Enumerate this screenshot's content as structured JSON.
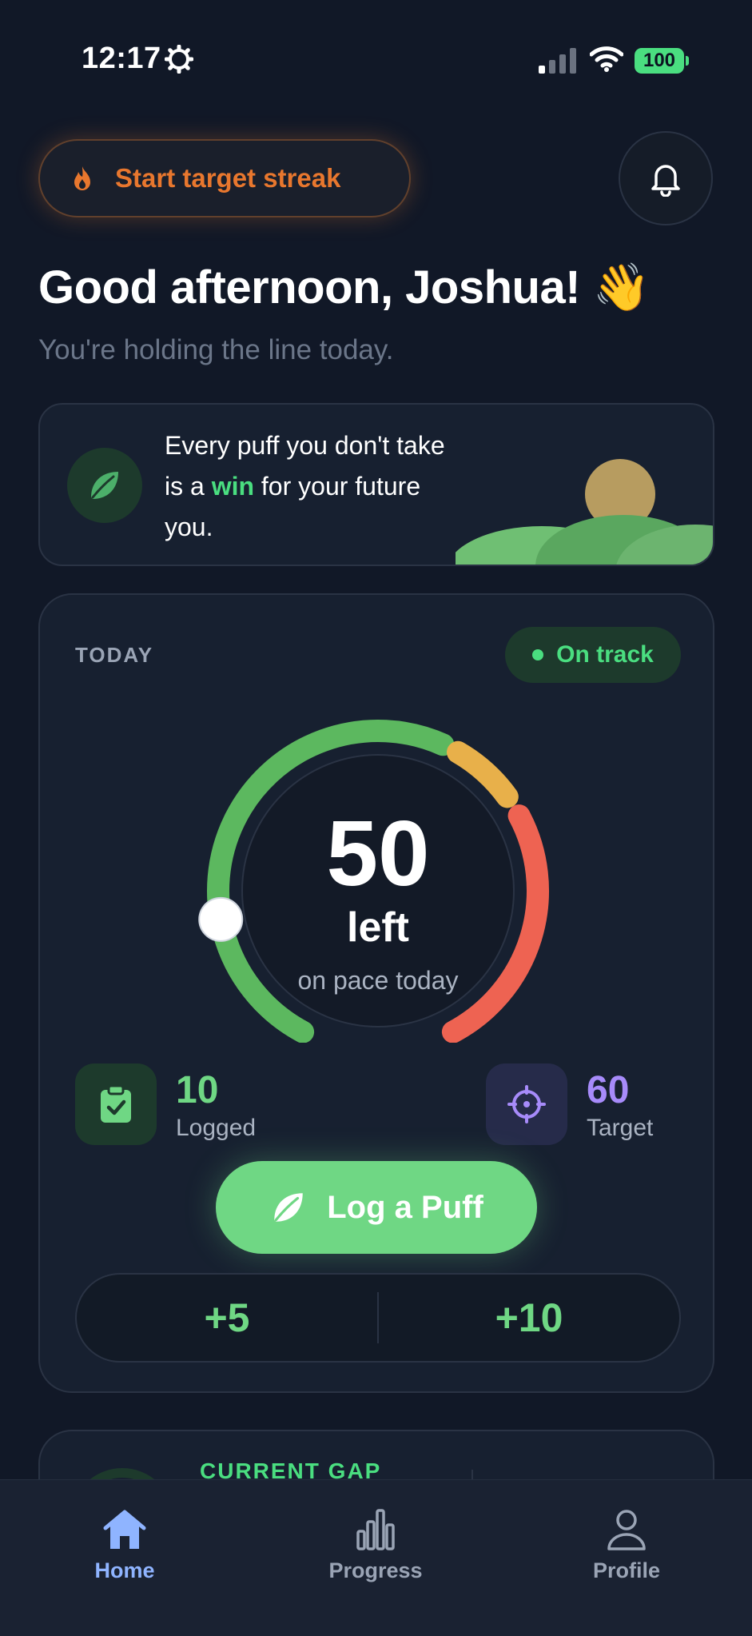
{
  "status_bar": {
    "time": "12:17",
    "battery": "100"
  },
  "header": {
    "streak_label": "Start target streak"
  },
  "greeting": {
    "title": "Good afternoon, Joshua! 👋",
    "subtitle": "You're holding the line today."
  },
  "quote": {
    "before": "Every puff you don't take is a",
    "highlight": "win",
    "after": "for your future you."
  },
  "today": {
    "label": "TODAY",
    "status": "On track",
    "remaining": "50",
    "remaining_label": "left",
    "pace_label": "on pace today",
    "progress_fraction": 0.17,
    "logged": {
      "value": "10",
      "label": "Logged"
    },
    "target": {
      "value": "60",
      "label": "Target"
    },
    "log_button": "Log a Puff",
    "quick_add": [
      "+5",
      "+10"
    ]
  },
  "gap_card": {
    "label": "CURRENT GAP"
  },
  "tabs": [
    {
      "label": "Home",
      "icon": "home-icon",
      "active": true
    },
    {
      "label": "Progress",
      "icon": "bar-chart-icon",
      "active": false
    },
    {
      "label": "Profile",
      "icon": "user-icon",
      "active": false
    }
  ],
  "colors": {
    "accent_green": "#6fd784",
    "streak_orange": "#e8772e",
    "active_tab": "#8fb4ff",
    "target_purple": "#a78bfa"
  }
}
